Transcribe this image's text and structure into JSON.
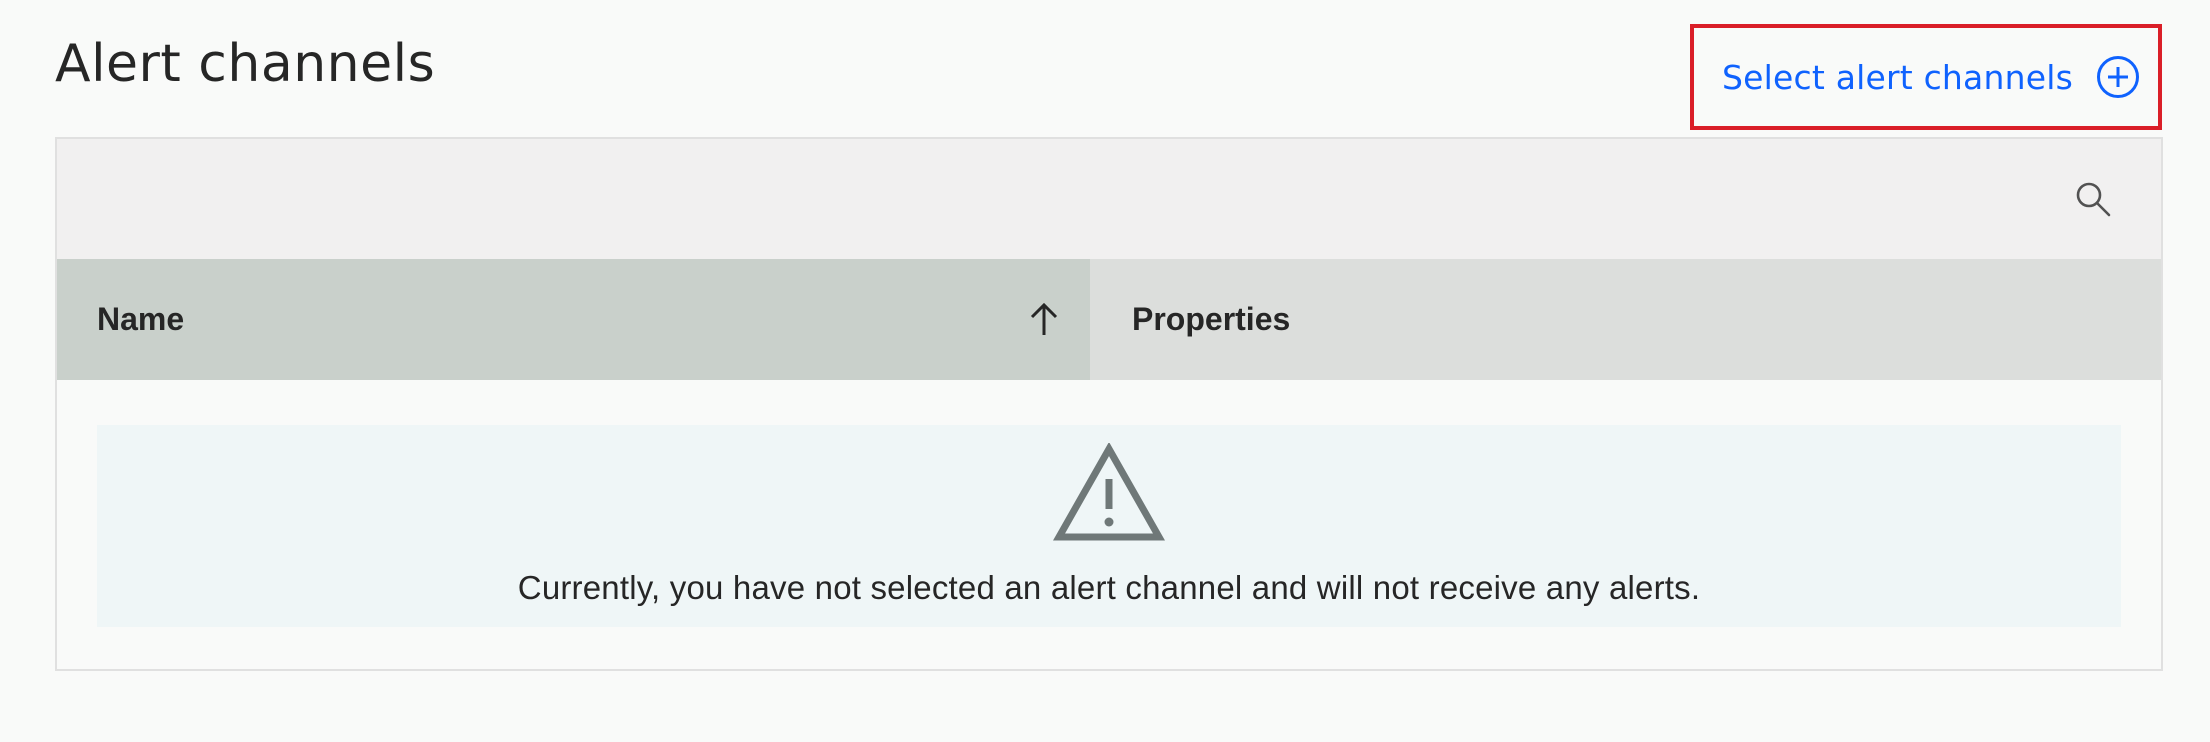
{
  "section": {
    "title": "Alert channels"
  },
  "actions": {
    "select_label": "Select alert channels",
    "select_icon": "plus-circle-icon",
    "highlight_color": "#da1e28",
    "link_color": "#0f62fe"
  },
  "toolbar": {
    "search_icon": "search-icon"
  },
  "table": {
    "columns": [
      {
        "label": "Name",
        "sort": "ascending",
        "sort_icon": "arrow-up-icon"
      },
      {
        "label": "Properties"
      }
    ],
    "rows": []
  },
  "empty_state": {
    "icon": "warning-icon",
    "message": "Currently, you have not selected an alert channel and will not receive any alerts."
  }
}
